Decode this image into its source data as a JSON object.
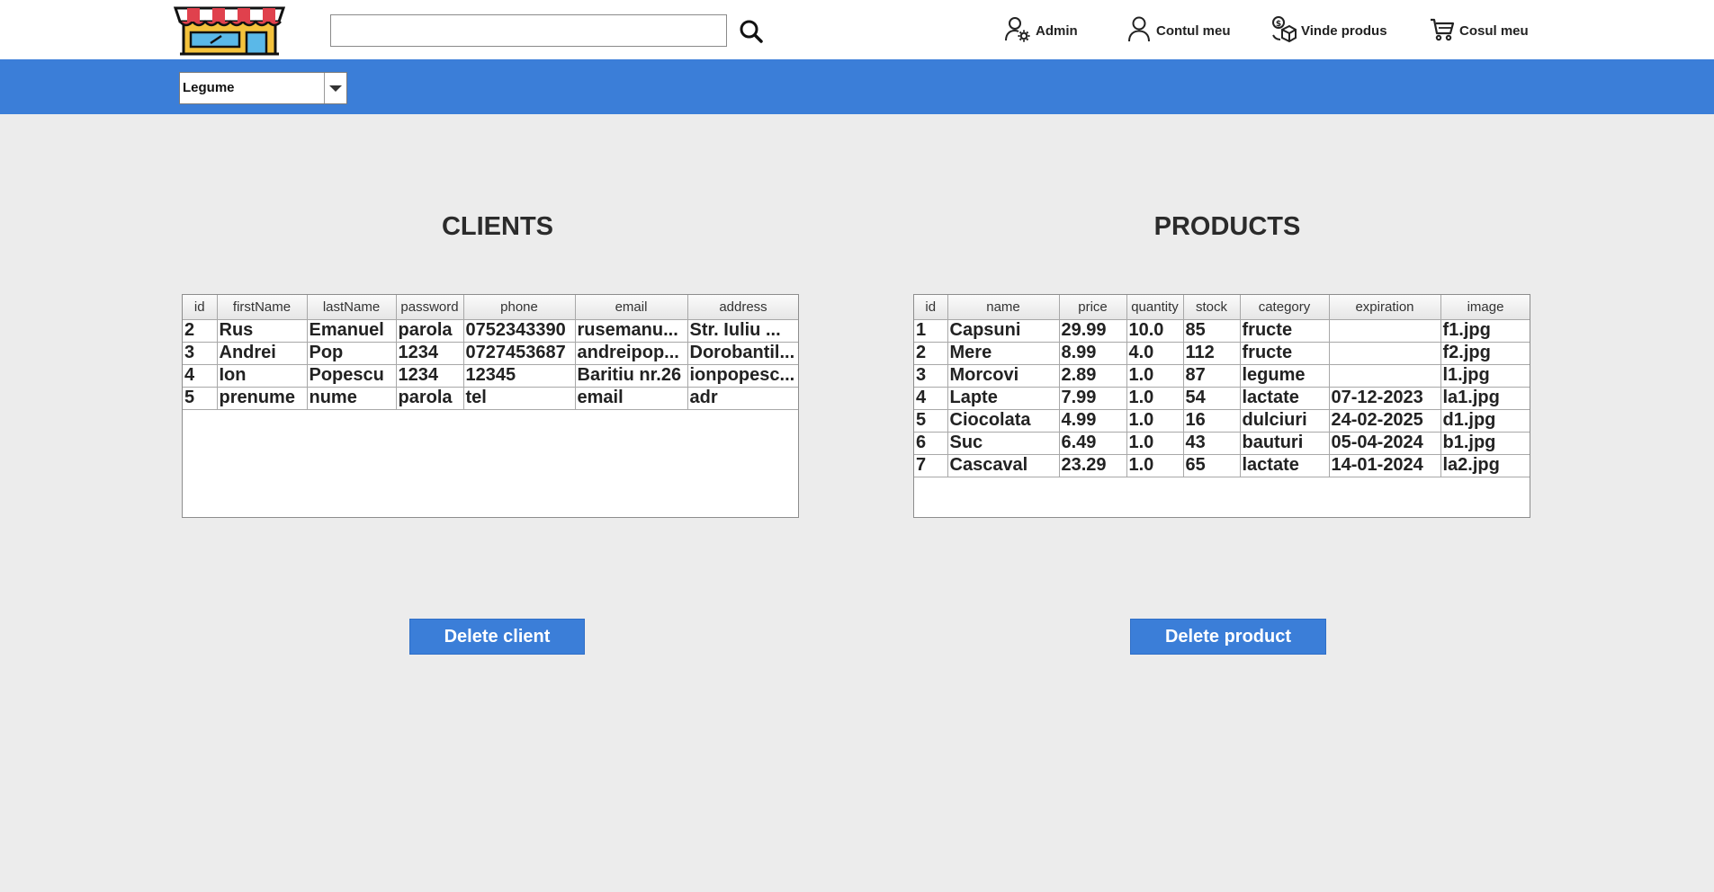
{
  "header": {
    "logo_icon": "shop-storefront-icon",
    "search": {
      "value": "",
      "placeholder": ""
    },
    "search_icon": "magnifier-icon",
    "nav": [
      {
        "label": "Admin",
        "icon": "user-gear-icon"
      },
      {
        "label": "Contul meu",
        "icon": "user-icon"
      },
      {
        "label": "Vinde produs",
        "icon": "sell-product-icon"
      },
      {
        "label": "Cosul meu",
        "icon": "shopping-cart-icon"
      }
    ]
  },
  "category_bar": {
    "selected": "Legume",
    "color": "#3b7ed8"
  },
  "clients": {
    "title": "CLIENTS",
    "columns": [
      "id",
      "firstName",
      "lastName",
      "password",
      "phone",
      "email",
      "address"
    ],
    "rows": [
      [
        "2",
        "Rus",
        "Emanuel",
        "parola",
        "0752343390",
        "rusemanu...",
        "Str. Iuliu ..."
      ],
      [
        "3",
        "Andrei",
        "Pop",
        "1234",
        "0727453687",
        "andreipop...",
        "Dorobantil..."
      ],
      [
        "4",
        "Ion",
        "Popescu",
        "1234",
        "12345",
        "Baritiu nr.26",
        "ionpopesc..."
      ],
      [
        "5",
        "prenume",
        "nume",
        "parola",
        "tel",
        "email",
        "adr"
      ]
    ],
    "delete_label": "Delete client"
  },
  "products": {
    "title": "PRODUCTS",
    "columns": [
      "id",
      "name",
      "price",
      "quantity",
      "stock",
      "category",
      "expiration",
      "image"
    ],
    "rows": [
      [
        "1",
        "Capsuni",
        "29.99",
        "10.0",
        "85",
        "fructe",
        "",
        "f1.jpg"
      ],
      [
        "2",
        "Mere",
        "8.99",
        "4.0",
        "112",
        "fructe",
        "",
        "f2.jpg"
      ],
      [
        "3",
        "Morcovi",
        "2.89",
        "1.0",
        "87",
        "legume",
        "",
        "l1.jpg"
      ],
      [
        "4",
        "Lapte",
        "7.99",
        "1.0",
        "54",
        "lactate",
        "07-12-2023",
        "la1.jpg"
      ],
      [
        "5",
        "Ciocolata",
        "4.99",
        "1.0",
        "16",
        "dulciuri",
        "24-02-2025",
        "d1.jpg"
      ],
      [
        "6",
        "Suc",
        "6.49",
        "1.0",
        "43",
        "bauturi",
        "05-04-2024",
        "b1.jpg"
      ],
      [
        "7",
        "Cascaval",
        "23.29",
        "1.0",
        "65",
        "lactate",
        "14-01-2024",
        "la2.jpg"
      ]
    ],
    "delete_label": "Delete product"
  }
}
